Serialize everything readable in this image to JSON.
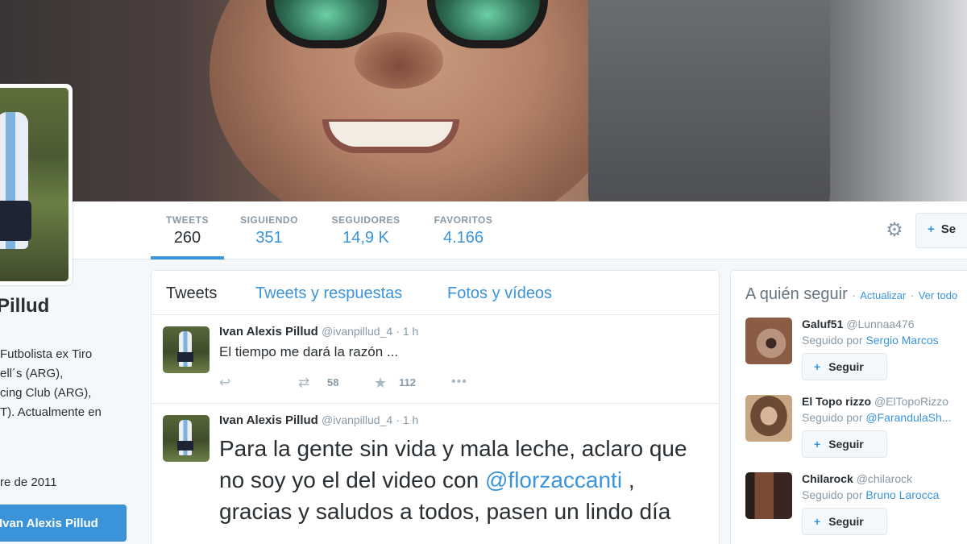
{
  "profile": {
    "name_partial": "Pillud",
    "bio_lines": [
      "Futbolista ex Tiro",
      "ell´s (ARG),",
      "cing Club (ARG),",
      "T). Actualmente en"
    ],
    "joined_partial": "re de 2011",
    "tweet_to_label": "Ivan Alexis Pillud"
  },
  "stats": [
    {
      "label": "TWEETS",
      "value": "260"
    },
    {
      "label": "SIGUIENDO",
      "value": "351"
    },
    {
      "label": "SEGUIDORES",
      "value": "14,9 K"
    },
    {
      "label": "FAVORITOS",
      "value": "4.166"
    }
  ],
  "header_actions": {
    "gear_icon": "⚙",
    "follow_label": "Se"
  },
  "timeline": {
    "tabs": [
      "Tweets",
      "Tweets y respuestas",
      "Fotos y vídeos"
    ],
    "tweets": [
      {
        "fullname": "Ivan Alexis Pillud",
        "username": "@ivanpillud_4",
        "time": "· 1 h",
        "text": "El tiempo me dará la razón ...",
        "retweets": "58",
        "favorites": "112"
      },
      {
        "fullname": "Ivan Alexis Pillud",
        "username": "@ivanpillud_4",
        "time": "· 1 h",
        "text_before": "Para la gente sin vida y mala leche, aclaro que no soy yo el del video con",
        "mention": "@florzaccanti",
        "text_after": " , gracias y saludos a todos, pasen un lindo día"
      }
    ]
  },
  "who_to_follow": {
    "title": "A quién seguir",
    "refresh": "Actualizar",
    "view_all": "Ver todo",
    "follow_label": "Seguir",
    "suggestions": [
      {
        "name": "Galuf51",
        "handle": "@Lunnaa476",
        "context_prefix": "Seguido por",
        "context_user": "Sergio Marcos"
      },
      {
        "name": "El Topo rizzo",
        "handle": "@ElTopoRizzo",
        "context_prefix": "Seguido por",
        "context_user": "@FarandulaSh..."
      },
      {
        "name": "Chilarock",
        "handle": "@chilarock",
        "context_prefix": "Seguido por",
        "context_user": "Bruno Larocca"
      }
    ]
  },
  "colors": {
    "accent": "#3b94d9",
    "text": "#292f33",
    "muted": "#8899a6",
    "background": "#f5f8fa"
  }
}
